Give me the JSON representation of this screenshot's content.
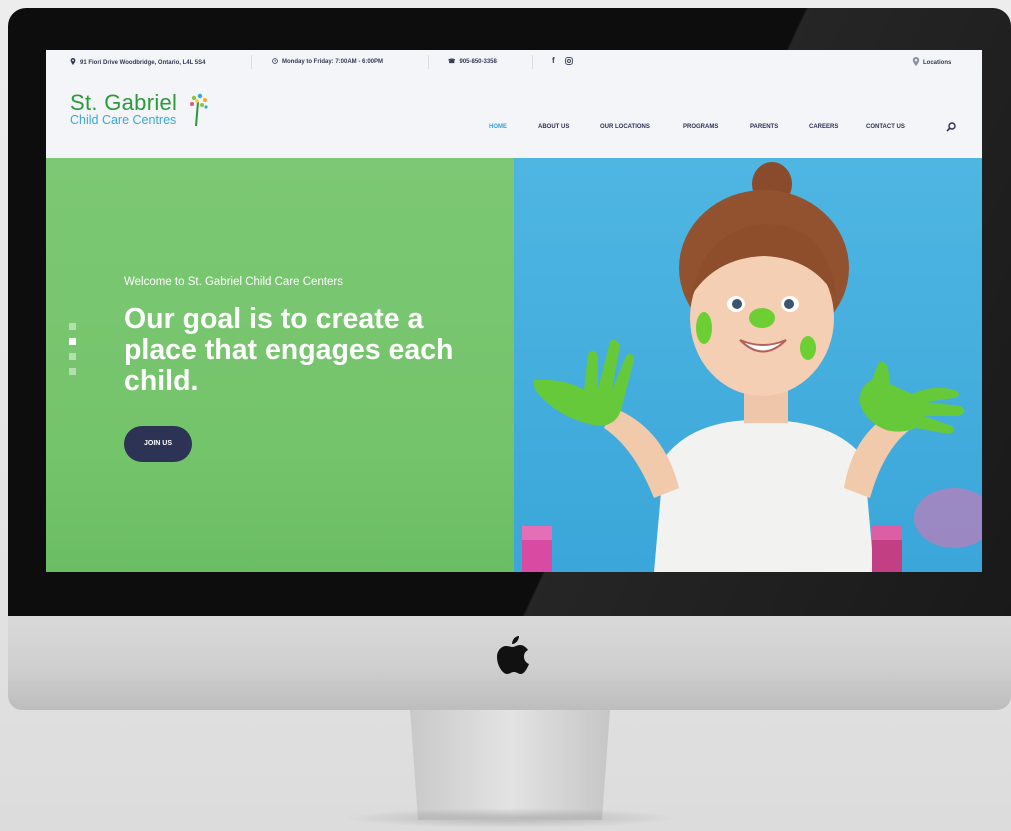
{
  "topbar": {
    "address": "91 Fiori Drive Woodbridge, Ontario, L4L 5S4",
    "hours": "Monday to Friday: 7:00AM - 6:00PM",
    "phone": "905-850-3358",
    "locations": "Locations"
  },
  "logo": {
    "name": "St. Gabriel",
    "tagline": "Child Care Centres"
  },
  "nav": {
    "items": [
      {
        "label": "HOME",
        "active": true
      },
      {
        "label": "ABOUT US",
        "active": false
      },
      {
        "label": "OUR LOCATIONS",
        "active": false
      },
      {
        "label": "PROGRAMS",
        "active": false
      },
      {
        "label": "PARENTS",
        "active": false
      },
      {
        "label": "CAREERS",
        "active": false
      },
      {
        "label": "CONTACT US",
        "active": false
      }
    ]
  },
  "hero": {
    "welcome": "Welcome to St. Gabriel Child Care Centers",
    "headline": "Our goal is to create a place that engages each child.",
    "cta": "JOIN US",
    "slides_total": 4,
    "active_slide": 2
  },
  "colors": {
    "brand_green": "#2a9a3b",
    "brand_blue": "#3aa7d9",
    "hero_green": "#78c670",
    "hero_blue": "#45b0df",
    "navy": "#2c3355"
  },
  "icons": [
    "map-pin-icon",
    "clock-icon",
    "phone-icon",
    "facebook-icon",
    "instagram-icon",
    "location-icon",
    "search-icon",
    "apple-logo-icon"
  ]
}
